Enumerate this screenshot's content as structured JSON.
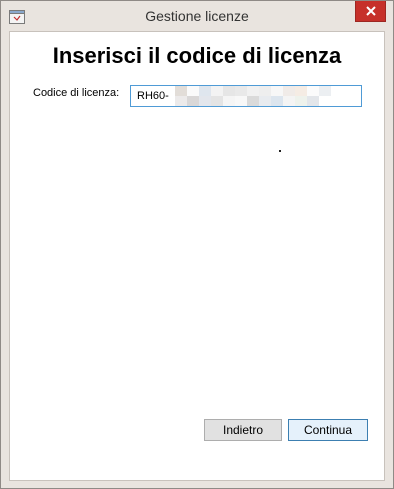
{
  "window": {
    "title": "Gestione licenze"
  },
  "main": {
    "heading": "Inserisci il codice di licenza",
    "license_label": "Codice di licenza:",
    "license_value": "RH60-"
  },
  "buttons": {
    "back_label": "Indietro",
    "continue_label": "Continua"
  },
  "colors": {
    "close_button": "#c6302a",
    "primary_button_border": "#3c7fb1",
    "input_border": "#4f9bd6"
  }
}
